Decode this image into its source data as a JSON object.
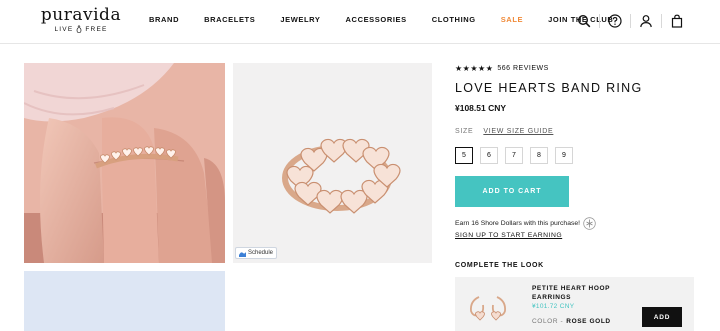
{
  "logo": {
    "main": "puravida",
    "sub_left": "LIVE",
    "sub_right": "FREE"
  },
  "nav": [
    {
      "label": "BRAND"
    },
    {
      "label": "BRACELETS"
    },
    {
      "label": "JEWELRY"
    },
    {
      "label": "ACCESSORIES"
    },
    {
      "label": "CLOTHING"
    },
    {
      "label": "SALE"
    },
    {
      "label": "JOIN THE CLUB"
    }
  ],
  "header_icons": [
    "search-icon",
    "help-icon",
    "account-icon",
    "bag-icon"
  ],
  "gallery": {
    "schedule_label": "Schedule"
  },
  "product": {
    "rating": 5,
    "reviews": "566 REVIEWS",
    "title": "LOVE HEARTS BAND RING",
    "price": "¥108.51 CNY",
    "size_label": "SIZE",
    "size_guide": "VIEW SIZE GUIDE",
    "sizes": [
      "5",
      "6",
      "7",
      "8",
      "9"
    ],
    "selected_size": "5",
    "add_to_cart": "ADD TO CART",
    "earn_text": "Earn 16 Shore Dollars with this purchase!",
    "signup": "SIGN UP TO START EARNING"
  },
  "complete_the_look": {
    "heading": "COMPLETE THE LOOK",
    "item": {
      "name": "PETITE HEART HOOP EARRINGS",
      "price": "¥101.72 CNY",
      "color_label": "COLOR -",
      "color_value": "ROSE GOLD",
      "add_label": "ADD"
    }
  },
  "colors": {
    "accent": "#45c4c1",
    "sale": "#f08a39",
    "text": "#111111"
  }
}
